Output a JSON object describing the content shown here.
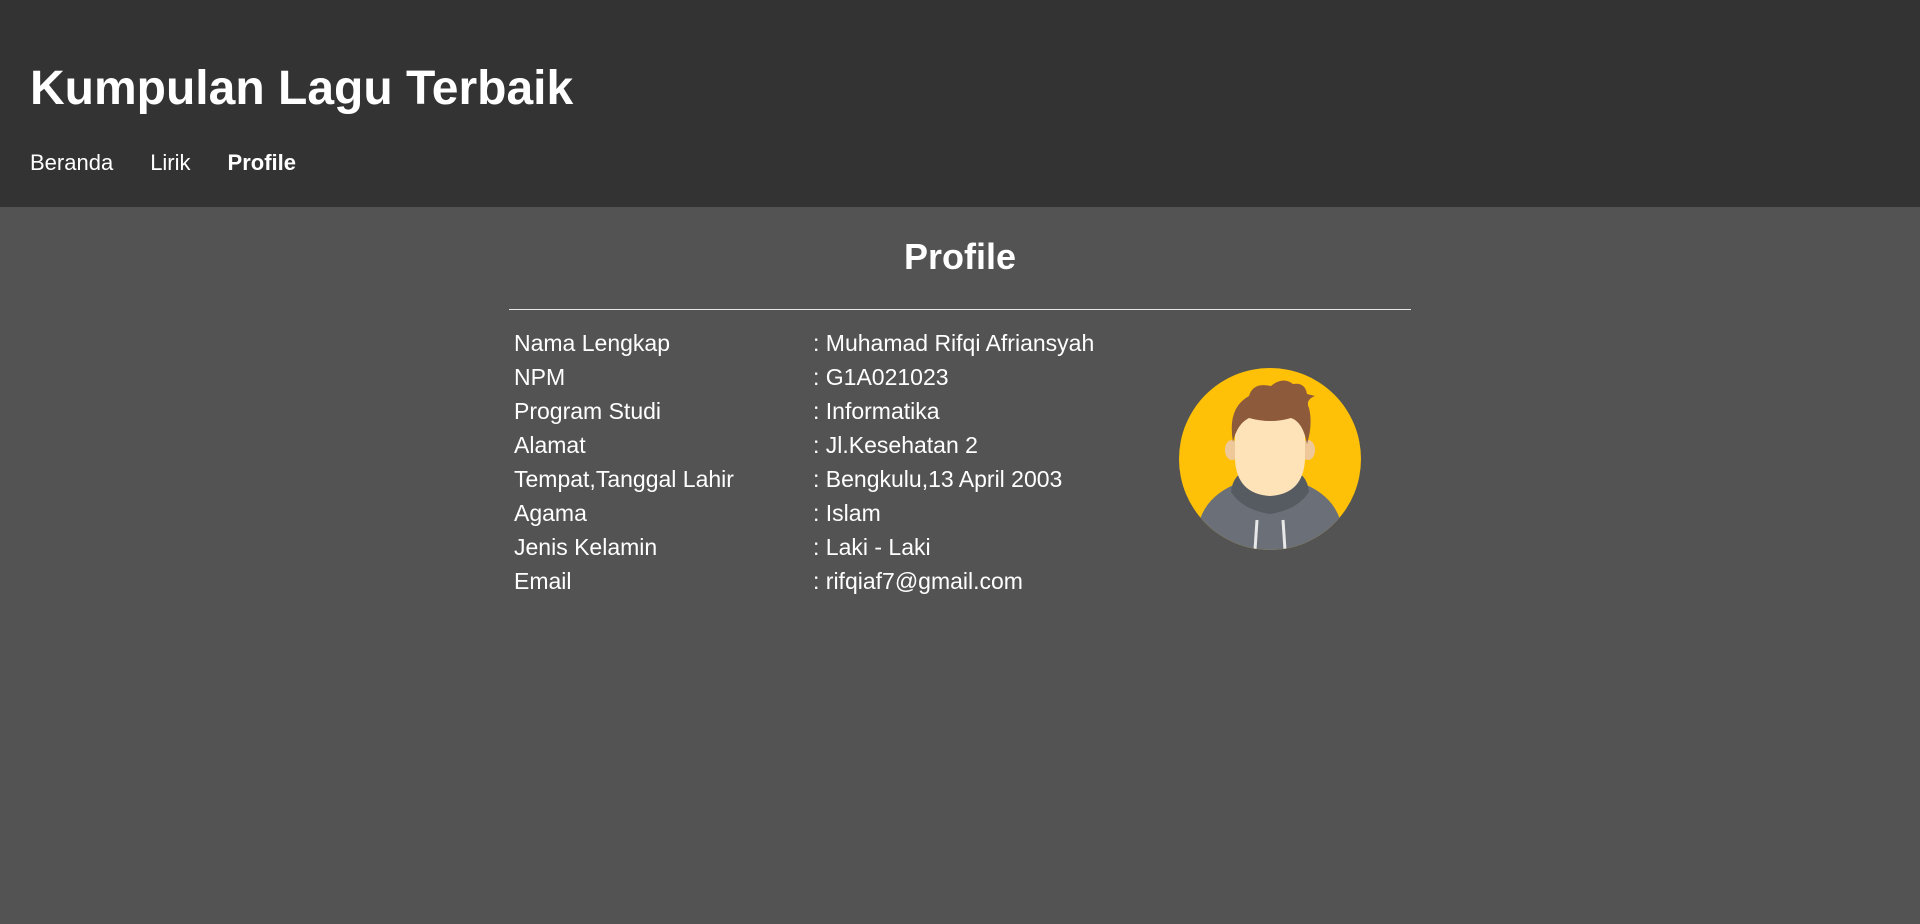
{
  "header": {
    "title": "Kumpulan Lagu Terbaik",
    "nav": [
      {
        "label": "Beranda",
        "active": false
      },
      {
        "label": "Lirik",
        "active": false
      },
      {
        "label": "Profile",
        "active": true
      }
    ]
  },
  "main": {
    "title": "Profile",
    "rows": [
      {
        "label": "Nama Lengkap",
        "value": ": Muhamad Rifqi Afriansyah"
      },
      {
        "label": "NPM",
        "value": ": G1A021023"
      },
      {
        "label": "Program Studi",
        "value": ": Informatika"
      },
      {
        "label": "Alamat",
        "value": ": Jl.Kesehatan 2"
      },
      {
        "label": "Tempat,Tanggal Lahir",
        "value": ": Bengkulu,13 April 2003"
      },
      {
        "label": "Agama",
        "value": ": Islam"
      },
      {
        "label": "Jenis Kelamin",
        "value": ": Laki - Laki"
      },
      {
        "label": "Email",
        "value": ": rifqiaf7@gmail.com"
      }
    ],
    "avatar_icon": "user-avatar-icon"
  },
  "colors": {
    "header_bg": "#333333",
    "body_bg": "#535353",
    "avatar_bg": "#FFC107"
  }
}
